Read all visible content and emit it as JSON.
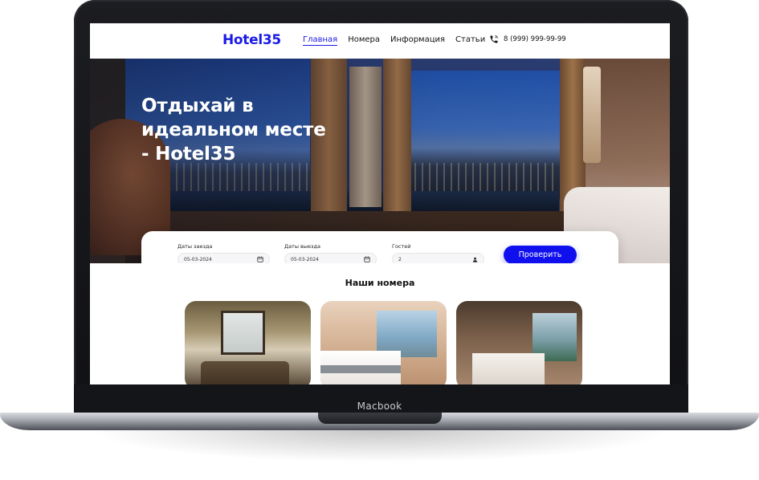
{
  "device": {
    "label": "Macbook"
  },
  "header": {
    "logo": "Hotel35",
    "nav": [
      {
        "label": "Главная",
        "active": true
      },
      {
        "label": "Номера",
        "active": false
      },
      {
        "label": "Информация",
        "active": false
      },
      {
        "label": "Статьи",
        "active": false
      }
    ],
    "phone": "8 (999) 999-99-99"
  },
  "hero": {
    "title": "Отдыхай в идеальном месте - Hotel35"
  },
  "booking": {
    "checkin_label": "Даты заезда",
    "checkin_value": "05-03-2024",
    "checkout_label": "Даты выезда",
    "checkout_value": "05-03-2024",
    "guests_label": "Гостей",
    "guests_value": "2",
    "submit_label": "Проверить"
  },
  "rooms": {
    "title": "Наши номера"
  },
  "colors": {
    "accent": "#1010ee",
    "logo": "#1a1ae6"
  }
}
